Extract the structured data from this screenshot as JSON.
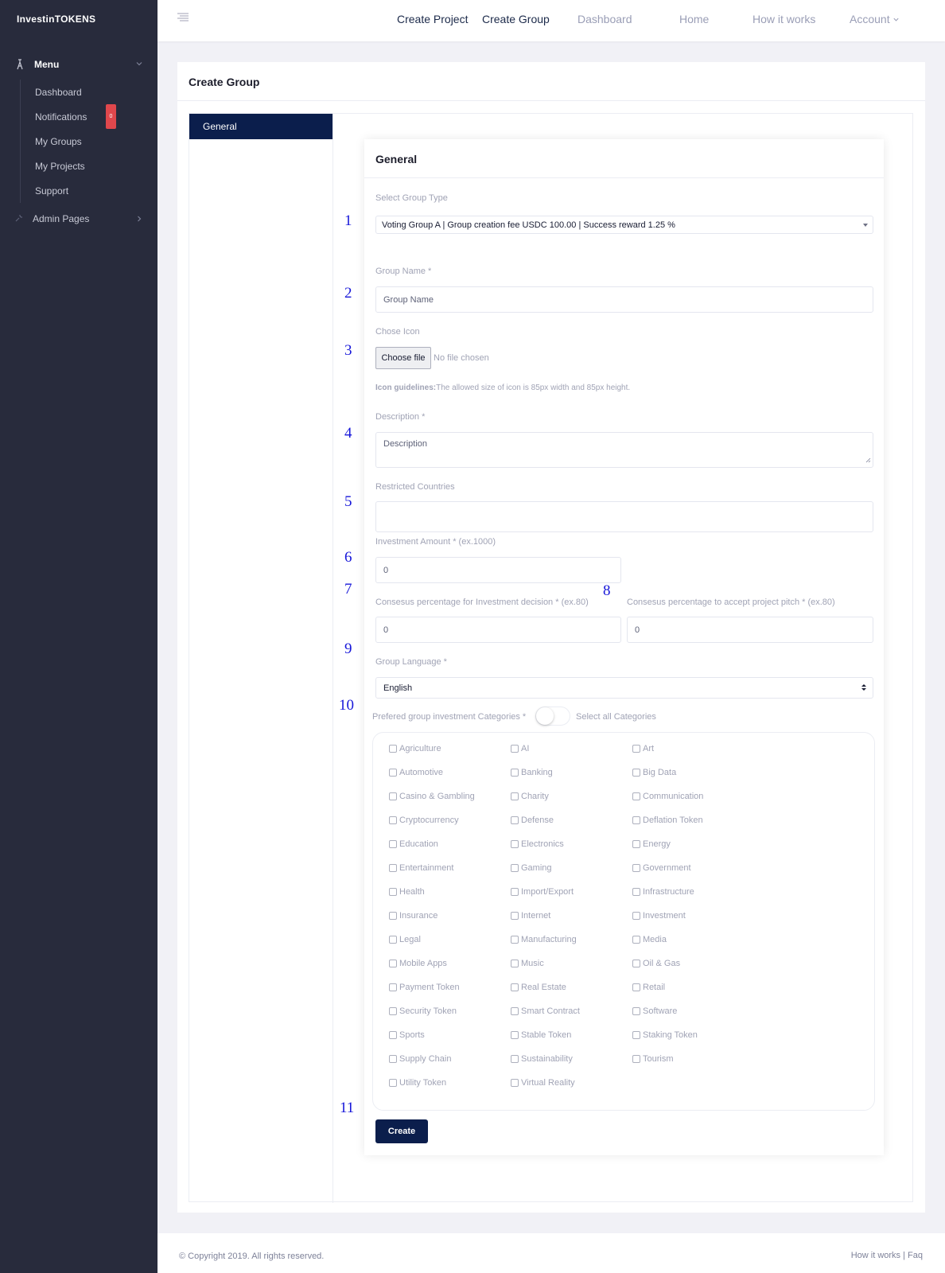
{
  "brand": "InvestinTOKENS",
  "sidebar": {
    "menu_label": "Menu",
    "items": [
      {
        "label": "Dashboard"
      },
      {
        "label": "Notifications"
      },
      {
        "label": "My Groups"
      },
      {
        "label": "My Projects"
      },
      {
        "label": "Support"
      }
    ],
    "notifications_badge": "0",
    "admin_label": "Admin Pages"
  },
  "topnav": {
    "create_project": "Create Project",
    "create_group": "Create Group",
    "dashboard": "Dashboard",
    "home": "Home",
    "how_it_works": "How it works",
    "account": "Account"
  },
  "page": {
    "title": "Create Group",
    "tab_general": "General",
    "panel_title": "General"
  },
  "form": {
    "group_type_label": "Select Group Type",
    "group_type_value": "Voting Group A | Group creation fee USDC 100.00 | Success reward 1.25 %",
    "group_name_label": "Group Name *",
    "group_name_placeholder": "Group Name",
    "icon_label": "Chose Icon",
    "choose_file": "Choose file",
    "no_file": "No file chosen",
    "icon_hint_bold": "Icon guidelines:",
    "icon_hint_text": "The allowed size of icon is 85px width and 85px height.",
    "description_label": "Description *",
    "description_placeholder": "Description",
    "restricted_label": "Restricted Countries",
    "investment_label": "Investment Amount * (ex.1000)",
    "investment_value": "0",
    "consensus_invest_label": "Consesus percentage for Investment decision * (ex.80)",
    "consensus_invest_value": "0",
    "consensus_pitch_label": "Consesus percentage to accept project pitch * (ex.80)",
    "consensus_pitch_value": "0",
    "language_label": "Group Language *",
    "language_value": "English",
    "categories_label": "Prefered group investment Categories *",
    "select_all_label": "Select all Categories",
    "create_button": "Create"
  },
  "categories": [
    [
      "Agriculture",
      "AI",
      "Art"
    ],
    [
      "Automotive",
      "Banking",
      "Big Data"
    ],
    [
      "Casino & Gambling",
      "Charity",
      "Communication"
    ],
    [
      "Cryptocurrency",
      "Defense",
      "Deflation Token"
    ],
    [
      "Education",
      "Electronics",
      "Energy"
    ],
    [
      "Entertainment",
      "Gaming",
      "Government"
    ],
    [
      "Health",
      "Import/Export",
      "Infrastructure"
    ],
    [
      "Insurance",
      "Internet",
      "Investment"
    ],
    [
      "Legal",
      "Manufacturing",
      "Media"
    ],
    [
      "Mobile Apps",
      "Music",
      "Oil & Gas"
    ],
    [
      "Payment Token",
      "Real Estate",
      "Retail"
    ],
    [
      "Security Token",
      "Smart Contract",
      "Software"
    ],
    [
      "Sports",
      "Stable Token",
      "Staking Token"
    ],
    [
      "Supply Chain",
      "Sustainability",
      "Tourism"
    ],
    [
      "Utility Token",
      "Virtual Reality"
    ]
  ],
  "annotations": [
    "1",
    "2",
    "3",
    "4",
    "5",
    "6",
    "7",
    "8",
    "9",
    "10",
    "11"
  ],
  "footer": {
    "copyright": "© Copyright 2019. All rights reserved.",
    "links": "How it works | Faq"
  },
  "colors": {
    "sidebar_bg": "#282b3c",
    "primary_navy": "#0b1e4c",
    "badge_red": "#e0474c",
    "annotation_blue": "#1717d9"
  }
}
